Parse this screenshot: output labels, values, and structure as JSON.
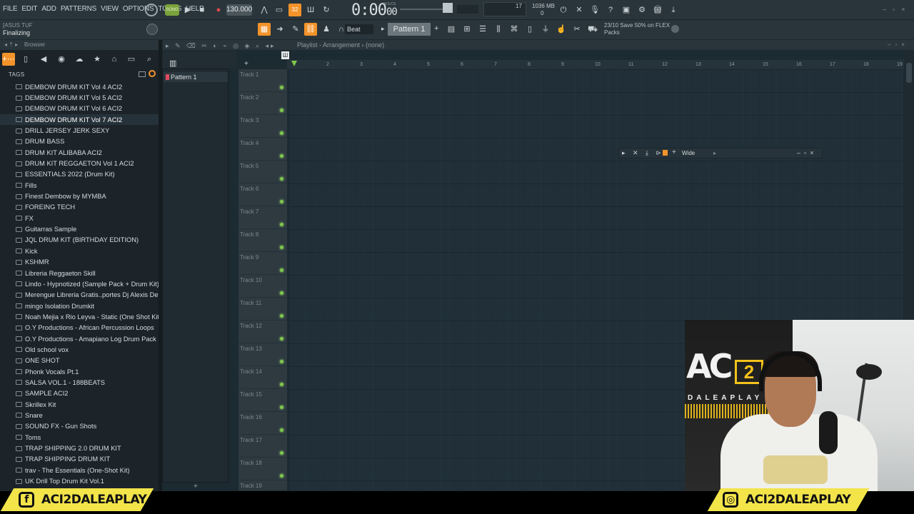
{
  "menu": [
    "FILE",
    "EDIT",
    "ADD",
    "PATTERNS",
    "VIEW",
    "OPTIONS",
    "TOOLS",
    "HELP"
  ],
  "transport": {
    "song_label": "SONG",
    "tempo": "130.000",
    "time": "0:00",
    "time_sub": "00",
    "time_unit": "M:S:CS"
  },
  "meters": {
    "cpu": "17",
    "memory": "1036 MB",
    "voices": "0"
  },
  "device": {
    "name": "[ASUS TUF",
    "hint": "Finalizing"
  },
  "toolbar2": {
    "snap": "Beat",
    "pattern": "Pattern 1",
    "news_title": "23/10  Save 50% on FLEX",
    "news_sub": "Packs"
  },
  "browser": {
    "title": "Browser",
    "tags_label": "TAGS",
    "folders": [
      "DEMBOW DRUM KIT Vol 4 ACI2",
      "DEMBOW DRUM KIT Vol 5 ACI2",
      "DEMBOW DRUM KIT Vol 6 ACI2",
      "DEMBOW DRUM KIT Vol 7 ACI2",
      "DRILL JERSEY JERK SEXY",
      "DRUM BASS",
      "DRUM KIT  ALIBABA ACI2",
      "DRUM KIT REGGAETON  Vol 1 ACI2",
      "ESSENTIALS 2022 (Drum Kit)",
      "Fills",
      "Finest Dembow by MYMBA",
      "FOREING TECH",
      "FX",
      "Guitarras Sample",
      "JQL DRUM KIT (BIRTHDAY EDITION)",
      "Kick",
      "KSHMR",
      "Libreria Reggaeton Skill",
      "Lindo - Hypnotized (Sample Pack + Drum Kit)",
      "Merengue Libreria Gratis..portes Dj Alexis Delgado",
      "mingo Isolation Drumkit",
      "Noah Mejia x Rio Leyva - Static (One Shot Kit)",
      "O.Y Productions - African Percussion Loops",
      "O.Y Productions - Amapiano Log Drum Pack",
      "Old school vox",
      "ONE SHOT",
      "Phonk Vocals Pt.1",
      "SALSA VOL.1 - 188BEATS",
      "SAMPLE ACI2",
      "Skrillex Kit",
      "Snare",
      "SOUND FX - Gun Shots",
      "Toms",
      "TRAP SHIPPING 2.0 DRUM KIT",
      "TRAP SHIPPING DRUM KIT",
      "trav - The Essentials (One-Shot Kit)",
      "UK Drill Top Drum Kit Vol.1"
    ],
    "selected_index": 3
  },
  "picker": {
    "item": "Pattern 1",
    "add": "+"
  },
  "playlist": {
    "title": "Playlist - Arrangement",
    "breadcrumb": "(none)",
    "tracks": [
      "Track 1",
      "Track 2",
      "Track 3",
      "Track 4",
      "Track 5",
      "Track 6",
      "Track 7",
      "Track 8",
      "Track 9",
      "Track 10",
      "Track 11",
      "Track 12",
      "Track 13",
      "Track 14",
      "Track 15",
      "Track 16",
      "Track 17",
      "Track 18",
      "Track 19"
    ],
    "bars": [
      "2",
      "3",
      "4",
      "5",
      "6",
      "7",
      "8",
      "9",
      "10",
      "11",
      "12",
      "13",
      "14",
      "15",
      "16",
      "17",
      "18",
      "19"
    ]
  },
  "float_window": {
    "label": "Wide"
  },
  "social": {
    "facebook": "ACI2DALEAPLAY",
    "instagram": "ACI2DALEAPLAY"
  },
  "webcam": {
    "logo": "AC",
    "logo_num": "2",
    "tagline": "DALEAPLAY"
  },
  "colors": {
    "accent": "#f3932a",
    "social_yellow": "#f3e44a",
    "led_green": "#7ec84b",
    "song_green": "#7aa33b"
  }
}
